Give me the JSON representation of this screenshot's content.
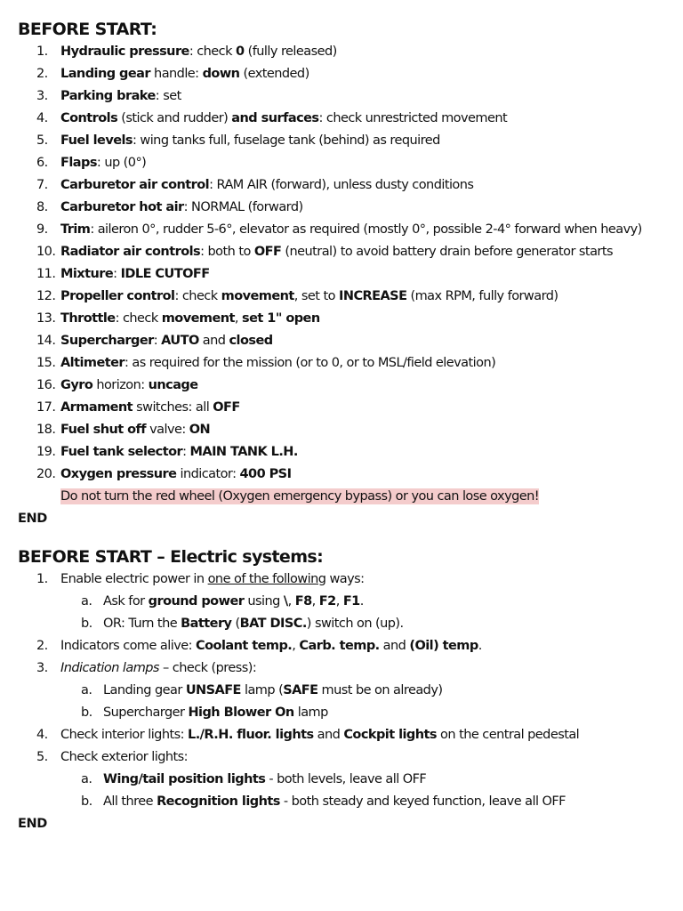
{
  "section1": {
    "title": "BEFORE START:",
    "items": [
      {
        "num": "1.",
        "parts": [
          {
            "t": "Hydraulic pressure",
            "b": true
          },
          {
            "t": ": check "
          },
          {
            "t": "0",
            "b": true
          },
          {
            "t": " (fully released)"
          }
        ]
      },
      {
        "num": "2.",
        "parts": [
          {
            "t": "Landing gear",
            "b": true
          },
          {
            "t": " handle: "
          },
          {
            "t": "down",
            "b": true
          },
          {
            "t": " (extended)"
          }
        ]
      },
      {
        "num": "3.",
        "parts": [
          {
            "t": "Parking brake",
            "b": true
          },
          {
            "t": ": set"
          }
        ]
      },
      {
        "num": "4.",
        "parts": [
          {
            "t": "Controls",
            "b": true
          },
          {
            "t": " (stick and rudder) "
          },
          {
            "t": "and surfaces",
            "b": true
          },
          {
            "t": ": check unrestricted movement"
          }
        ]
      },
      {
        "num": "5.",
        "parts": [
          {
            "t": "Fuel levels",
            "b": true
          },
          {
            "t": ": wing tanks full, fuselage tank (behind) as required"
          }
        ]
      },
      {
        "num": "6.",
        "parts": [
          {
            "t": "Flaps",
            "b": true
          },
          {
            "t": ": up (0°)"
          }
        ]
      },
      {
        "num": "7.",
        "parts": [
          {
            "t": "Carburetor air control",
            "b": true
          },
          {
            "t": ": RAM AIR (forward), unless dusty conditions"
          }
        ]
      },
      {
        "num": "8.",
        "parts": [
          {
            "t": "Carburetor hot air",
            "b": true
          },
          {
            "t": ": NORMAL (forward)"
          }
        ]
      },
      {
        "num": "9.",
        "parts": [
          {
            "t": "Trim",
            "b": true
          },
          {
            "t": ": aileron 0°, rudder 5-6°, elevator as required (mostly 0°, possible 2-4° forward when heavy)"
          }
        ]
      },
      {
        "num": "10.",
        "parts": [
          {
            "t": "Radiator air controls",
            "b": true
          },
          {
            "t": ": both to "
          },
          {
            "t": "OFF",
            "b": true
          },
          {
            "t": " (neutral) to avoid battery drain before generator starts"
          }
        ]
      },
      {
        "num": "11.",
        "parts": [
          {
            "t": "Mixture",
            "b": true
          },
          {
            "t": ": "
          },
          {
            "t": "IDLE CUTOFF",
            "b": true
          }
        ]
      },
      {
        "num": "12.",
        "parts": [
          {
            "t": "Propeller control",
            "b": true
          },
          {
            "t": ": check "
          },
          {
            "t": "movement",
            "b": true
          },
          {
            "t": ", set to "
          },
          {
            "t": "INCREASE",
            "b": true
          },
          {
            "t": " (max RPM, fully forward)"
          }
        ]
      },
      {
        "num": "13.",
        "parts": [
          {
            "t": "Throttle",
            "b": true
          },
          {
            "t": ": check "
          },
          {
            "t": "movement",
            "b": true
          },
          {
            "t": ", "
          },
          {
            "t": "set 1\" open",
            "b": true
          }
        ]
      },
      {
        "num": "14.",
        "parts": [
          {
            "t": "Supercharger",
            "b": true
          },
          {
            "t": ": "
          },
          {
            "t": "AUTO",
            "b": true
          },
          {
            "t": " and "
          },
          {
            "t": "closed",
            "b": true
          }
        ]
      },
      {
        "num": "15.",
        "parts": [
          {
            "t": "Altimeter",
            "b": true
          },
          {
            "t": ": as required for the mission (or to 0, or to MSL/field elevation)"
          }
        ]
      },
      {
        "num": "16.",
        "parts": [
          {
            "t": "Gyro",
            "b": true
          },
          {
            "t": " horizon: "
          },
          {
            "t": "uncage",
            "b": true
          }
        ]
      },
      {
        "num": "17.",
        "parts": [
          {
            "t": "Armament",
            "b": true
          },
          {
            "t": " switches: all "
          },
          {
            "t": "OFF",
            "b": true
          }
        ]
      },
      {
        "num": "18.",
        "parts": [
          {
            "t": "Fuel shut off",
            "b": true
          },
          {
            "t": " valve: "
          },
          {
            "t": "ON",
            "b": true
          }
        ]
      },
      {
        "num": "19.",
        "parts": [
          {
            "t": "Fuel tank selector",
            "b": true
          },
          {
            "t": ": "
          },
          {
            "t": "MAIN TANK L.H.",
            "b": true
          }
        ]
      },
      {
        "num": "20.",
        "parts": [
          {
            "t": "Oxygen pressure",
            "b": true
          },
          {
            "t": " indicator: "
          },
          {
            "t": "400 PSI",
            "b": true
          }
        ]
      }
    ],
    "warning": "Do not turn the red wheel (Oxygen emergency bypass) or you can lose oxygen!",
    "end": "END"
  },
  "section2": {
    "title": "BEFORE START – Electric systems:",
    "items": [
      {
        "num": "1.",
        "parts": [
          {
            "t": "Enable electric power in "
          },
          {
            "t": "one of the following",
            "u": true
          },
          {
            "t": " ways:"
          }
        ],
        "sub": [
          {
            "num": "a.",
            "parts": [
              {
                "t": "Ask for "
              },
              {
                "t": "ground power",
                "b": true
              },
              {
                "t": " using "
              },
              {
                "t": "\\",
                "b": true
              },
              {
                "t": ", "
              },
              {
                "t": "F8",
                "b": true
              },
              {
                "t": ", "
              },
              {
                "t": "F2",
                "b": true
              },
              {
                "t": ", "
              },
              {
                "t": "F1",
                "b": true
              },
              {
                "t": "."
              }
            ]
          },
          {
            "num": "b.",
            "parts": [
              {
                "t": "OR: Turn the "
              },
              {
                "t": "Battery",
                "b": true
              },
              {
                "t": " ("
              },
              {
                "t": "BAT DISC.",
                "b": true
              },
              {
                "t": ") switch on (up)."
              }
            ]
          }
        ]
      },
      {
        "num": "2.",
        "parts": [
          {
            "t": "Indicators come alive: "
          },
          {
            "t": "Coolant temp.",
            "b": true
          },
          {
            "t": ", "
          },
          {
            "t": "Carb. temp.",
            "b": true
          },
          {
            "t": " and "
          },
          {
            "t": "(Oil) temp",
            "b": true
          },
          {
            "t": "."
          }
        ]
      },
      {
        "num": "3.",
        "parts": [
          {
            "t": "Indication lamps",
            "i": true
          },
          {
            "t": " – check (press):"
          }
        ],
        "sub": [
          {
            "num": "a.",
            "parts": [
              {
                "t": "Landing gear "
              },
              {
                "t": "UNSAFE",
                "b": true
              },
              {
                "t": " lamp ("
              },
              {
                "t": "SAFE",
                "b": true
              },
              {
                "t": " must be on already)"
              }
            ]
          },
          {
            "num": "b.",
            "parts": [
              {
                "t": "Supercharger "
              },
              {
                "t": "High Blower On",
                "b": true
              },
              {
                "t": " lamp"
              }
            ]
          }
        ]
      },
      {
        "num": "4.",
        "parts": [
          {
            "t": "Check interior lights: "
          },
          {
            "t": "L./R.H. fluor. lights",
            "b": true
          },
          {
            "t": " and "
          },
          {
            "t": "Cockpit lights",
            "b": true
          },
          {
            "t": " on the central pedestal"
          }
        ]
      },
      {
        "num": "5.",
        "parts": [
          {
            "t": "Check exterior lights:"
          }
        ],
        "sub": [
          {
            "num": "a.",
            "parts": [
              {
                "t": "Wing/tail position lights",
                "b": true
              },
              {
                "t": " - both levels, leave all OFF"
              }
            ]
          },
          {
            "num": "b.",
            "parts": [
              {
                "t": "All three "
              },
              {
                "t": "Recognition lights",
                "b": true
              },
              {
                "t": " - both steady and keyed function, leave all OFF"
              }
            ]
          }
        ]
      }
    ],
    "end": "END"
  }
}
